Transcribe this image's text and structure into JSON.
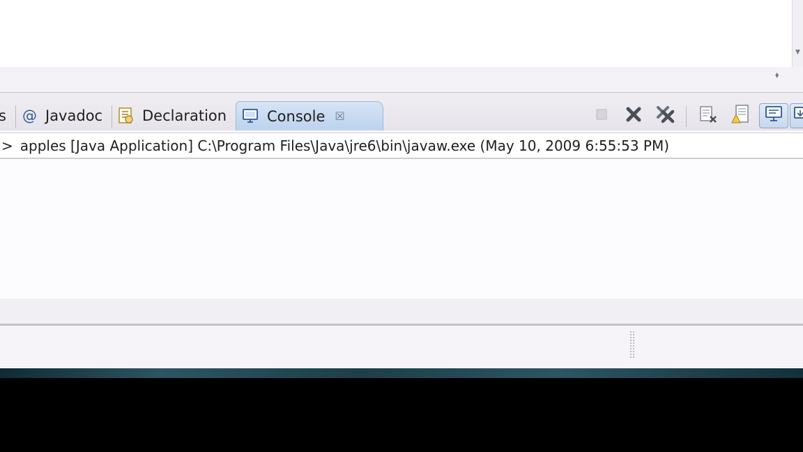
{
  "tabs": {
    "partial_label": "s",
    "javadoc_label": "Javadoc",
    "declaration_label": "Declaration",
    "console_label": "Console"
  },
  "console": {
    "prefix": ">",
    "header_text": "apples [Java Application] C:\\Program Files\\Java\\jre6\\bin\\javaw.exe (May 10, 2009 6:55:53 PM)"
  },
  "icons": {
    "javadoc": "at-icon",
    "declaration": "declaration-icon",
    "console": "console-icon",
    "toolbar": [
      "terminate-icon",
      "remove-launch-icon",
      "remove-all-terminated-icon",
      "clear-console-icon",
      "scroll-lock-icon",
      "pin-console-icon",
      "display-selected-console-icon"
    ]
  },
  "colors": {
    "active_tab": "#c8daf2",
    "background": "#f9f7fb",
    "taskbar": "#000000"
  }
}
